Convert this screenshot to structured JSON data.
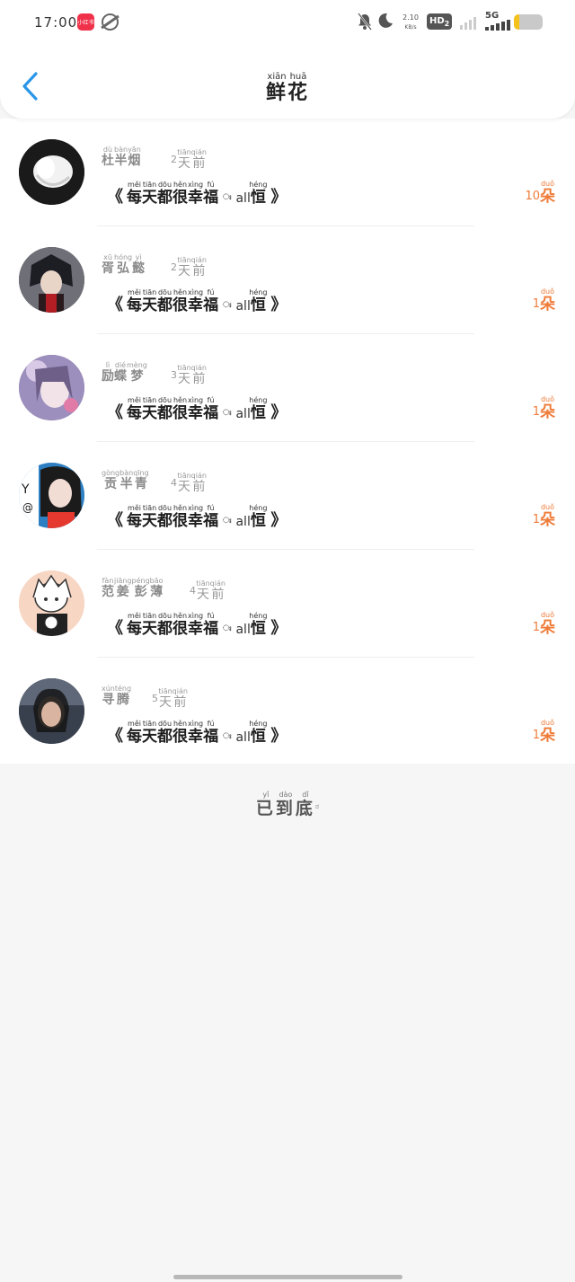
{
  "status_bar": {
    "time": "17:00",
    "app1_label": "小红书",
    "net_speed_value": "2.10",
    "net_speed_unit": "KB/s",
    "hd_label": "HD",
    "hd_sub": "2",
    "network_label": "5G",
    "battery_level_percent": 20
  },
  "header": {
    "title_chars": [
      {
        "char": "鲜",
        "pinyin": "xiān"
      },
      {
        "char": "花",
        "pinyin": "huā"
      }
    ]
  },
  "list": {
    "items": [
      {
        "name": [
          {
            "char": "杜",
            "pinyin": "dù"
          },
          {
            "char": "半",
            "pinyin": "bàn"
          },
          {
            "char": "烟",
            "pinyin": "yān"
          }
        ],
        "time_num": "2",
        "time_chars": [
          {
            "char": "天",
            "pinyin": "tiān"
          },
          {
            "char": "前",
            "pinyin": "qián"
          }
        ],
        "count": "10",
        "unit": {
          "char": "朵",
          "pinyin": "duǒ"
        }
      },
      {
        "name": [
          {
            "char": "胥",
            "pinyin": "xū"
          },
          {
            "char": "弘",
            "pinyin": "hóng"
          },
          {
            "char": "懿",
            "pinyin": "yì"
          }
        ],
        "time_num": "2",
        "time_chars": [
          {
            "char": "天",
            "pinyin": "tiān"
          },
          {
            "char": "前",
            "pinyin": "qián"
          }
        ],
        "count": "1",
        "unit": {
          "char": "朵",
          "pinyin": "duǒ"
        }
      },
      {
        "name": [
          {
            "char": "励",
            "pinyin": "lì"
          },
          {
            "char": "蝶",
            "pinyin": "dié"
          },
          {
            "char": "梦",
            "pinyin": "mèng"
          }
        ],
        "time_num": "3",
        "time_chars": [
          {
            "char": "天",
            "pinyin": "tiān"
          },
          {
            "char": "前",
            "pinyin": "qián"
          }
        ],
        "count": "1",
        "unit": {
          "char": "朵",
          "pinyin": "duǒ"
        }
      },
      {
        "name": [
          {
            "char": "贡",
            "pinyin": "gòng"
          },
          {
            "char": "半",
            "pinyin": "bàn"
          },
          {
            "char": "青",
            "pinyin": "qīng"
          }
        ],
        "time_num": "4",
        "time_chars": [
          {
            "char": "天",
            "pinyin": "tiān"
          },
          {
            "char": "前",
            "pinyin": "qián"
          }
        ],
        "count": "1",
        "unit": {
          "char": "朵",
          "pinyin": "duǒ"
        }
      },
      {
        "name": [
          {
            "char": "范",
            "pinyin": "fàn"
          },
          {
            "char": "姜",
            "pinyin": "jiāng"
          },
          {
            "char": "彭",
            "pinyin": "péng"
          },
          {
            "char": "薄",
            "pinyin": "bāo"
          }
        ],
        "time_num": "4",
        "time_chars": [
          {
            "char": "天",
            "pinyin": "tiān"
          },
          {
            "char": "前",
            "pinyin": "qián"
          }
        ],
        "count": "1",
        "unit": {
          "char": "朵",
          "pinyin": "duǒ"
        }
      },
      {
        "name": [
          {
            "char": "寻",
            "pinyin": "xún"
          },
          {
            "char": "腾",
            "pinyin": "téng"
          }
        ],
        "time_num": "5",
        "time_chars": [
          {
            "char": "天",
            "pinyin": "tiān"
          },
          {
            "char": "前",
            "pinyin": "qián"
          }
        ],
        "count": "1",
        "unit": {
          "char": "朵",
          "pinyin": "duǒ"
        }
      }
    ],
    "message": {
      "open_bracket": "《",
      "chars": [
        {
          "char": "每",
          "pinyin": "měi"
        },
        {
          "char": "天",
          "pinyin": "tiān"
        },
        {
          "char": "都",
          "pinyin": "dōu"
        },
        {
          "char": "很",
          "pinyin": "hěn"
        },
        {
          "char": "幸",
          "pinyin": "xìng"
        },
        {
          "char": "福",
          "pinyin": "fú"
        }
      ],
      "colon": "ಃ",
      "latin": "all",
      "last": {
        "char": "恒",
        "pinyin": "héng"
      },
      "close_bracket": "》"
    },
    "avatars": [
      "white-flower-avatar",
      "anime-ninja-avatar",
      "anime-girl-avatar",
      "girl-photo-avatar",
      "sketch-boy-avatar",
      "woman-photo-avatar"
    ],
    "avatar_colors": [
      "#3a3a3a",
      "#4a4a55",
      "#8a7ba6",
      "#2d7fc1",
      "#f6d8c8",
      "#4a5566"
    ]
  },
  "footer": {
    "chars": [
      {
        "char": "已",
        "pinyin": "yǐ"
      },
      {
        "char": "到",
        "pinyin": "dào"
      },
      {
        "char": "底",
        "pinyin": "dǐ"
      }
    ],
    "emoji": "ಠ"
  },
  "accent_color": "#ef7b38",
  "back_color": "#2b96e8"
}
